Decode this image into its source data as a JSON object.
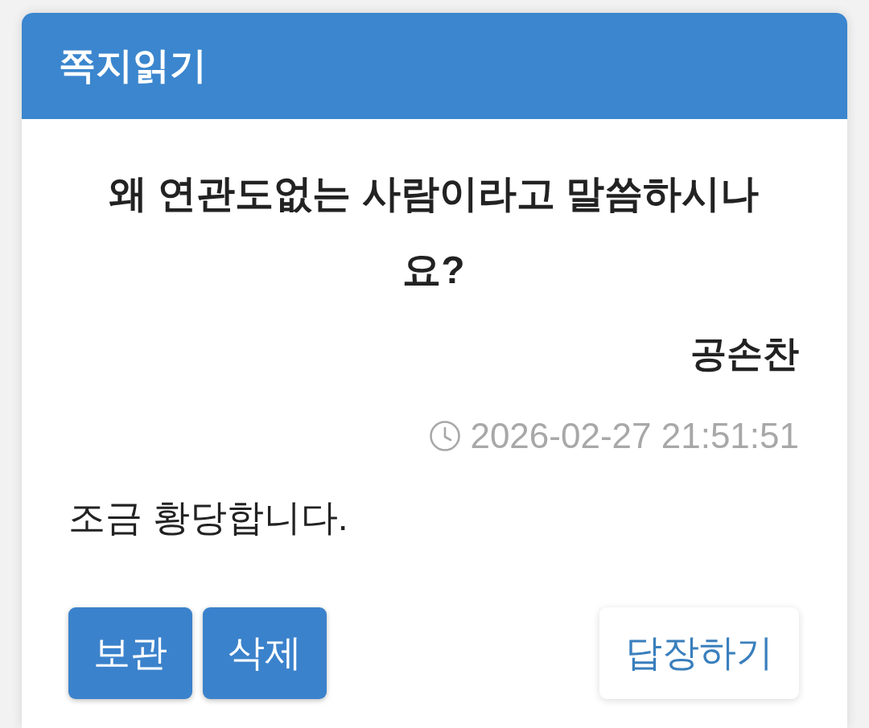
{
  "header": {
    "title": "쪽지읽기"
  },
  "message": {
    "subject": "왜 연관도없는 사람이라고 말씀하시나요?",
    "sender": "공손찬",
    "sent_at": "2026-02-27 21:51:51",
    "body": "조금 황당합니다."
  },
  "actions": [
    {
      "label": "보관",
      "kind": "primary"
    },
    {
      "label": "삭제",
      "kind": "primary"
    },
    {
      "label": "답장하기",
      "kind": "secondary"
    }
  ]
}
